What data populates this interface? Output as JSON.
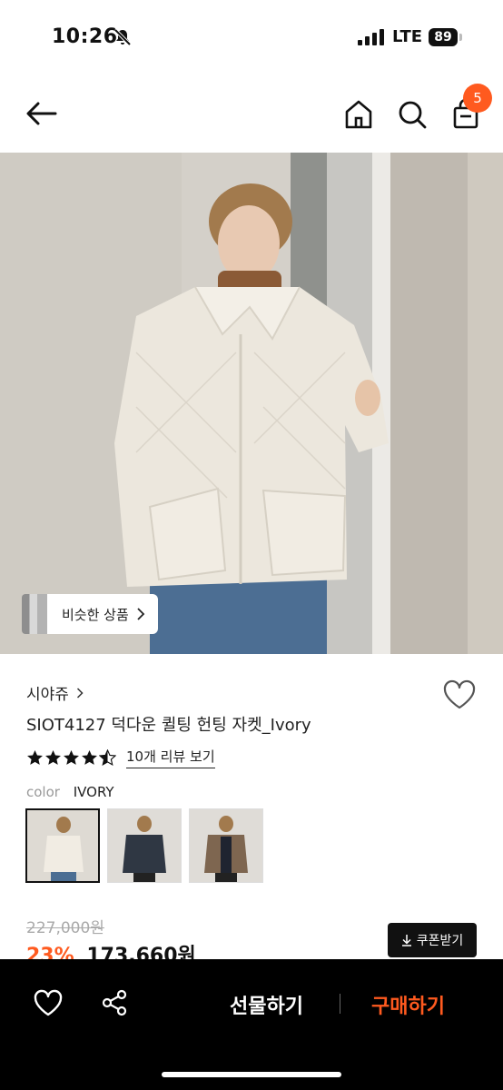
{
  "status_bar": {
    "time": "10:26",
    "network": "LTE",
    "battery": "89"
  },
  "header": {
    "cart_count": "5"
  },
  "hero": {
    "similar_label": "비슷한 상품"
  },
  "product": {
    "brand": "시야쥬",
    "title": "SIOT4127 덕다운 퀼팅 헌팅 자켓_Ivory",
    "rating": 4.5,
    "review_link": "10개 리뷰 보기",
    "color_label": "color",
    "color_value": "IVORY",
    "swatches": [
      "ivory",
      "navy",
      "brown"
    ],
    "original_price": "227,000원",
    "discount": "23%",
    "price": "173,660원",
    "coupon_label": "쿠폰받기"
  },
  "bottom_bar": {
    "gift_label": "선물하기",
    "buy_label": "구매하기"
  },
  "colors": {
    "accent": "#ff5a1f",
    "dark": "#111111"
  }
}
